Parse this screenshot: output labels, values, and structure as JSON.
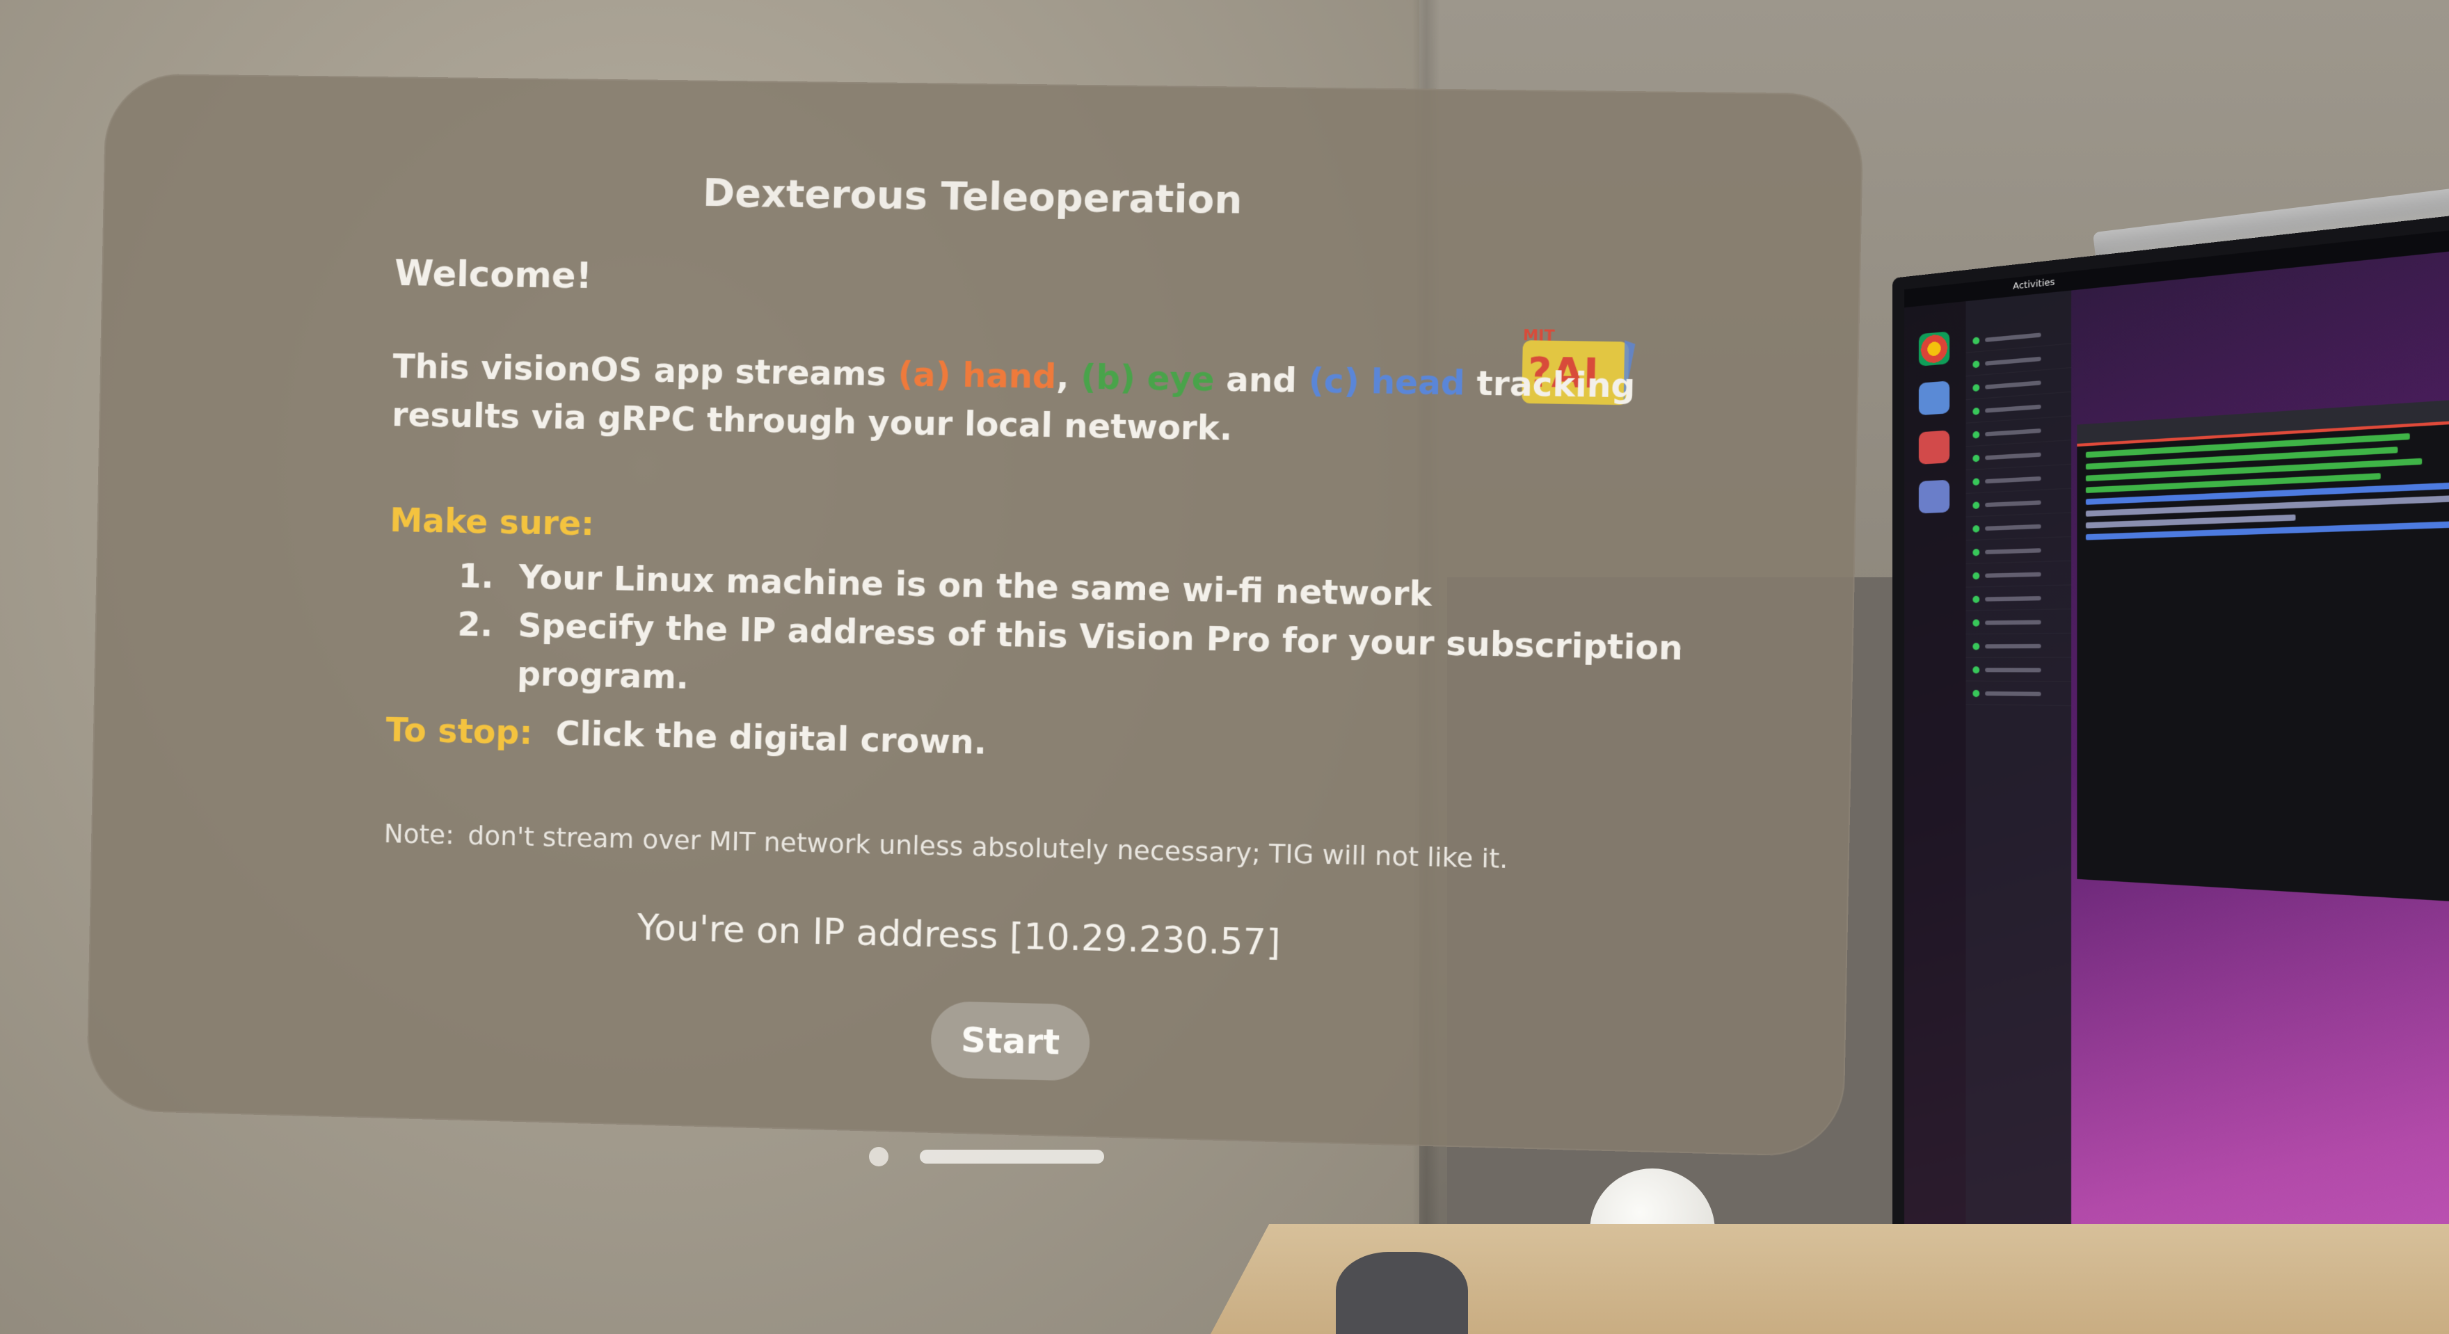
{
  "window": {
    "title": "Dexterous Teleoperation",
    "welcome": "Welcome!",
    "intro": {
      "part1": "This visionOS app streams ",
      "hand": "(a) hand",
      "sep1": ", ",
      "eye": "(b) eye",
      "sep2": " and ",
      "head": "(c) head",
      "part2": " tracking results via gRPC through  your local network."
    },
    "make_sure_label": "Make sure:",
    "steps": [
      "Your Linux machine is on the same wi-fi network",
      "Specify the IP address of this Vision Pro for your subscription program."
    ],
    "to_stop_label": "To stop:",
    "to_stop_text": "Click the digital crown.",
    "note_label": "Note:",
    "note_text": "don't stream over MIT network unless absolutely necessary; TIG will not like it.",
    "ip_text": "You're on IP address [10.29.230.57]",
    "start_label": "Start",
    "logo_text_top": "MIT",
    "logo_text_main": "ImprobableAI"
  },
  "monitor": {
    "topbar_label": "Activities"
  },
  "colors": {
    "hand": "#ef7a3b",
    "eye": "#49a34a",
    "head": "#5a86d8",
    "accent_yellow": "#f4c33f",
    "panel": "#857c6c"
  }
}
